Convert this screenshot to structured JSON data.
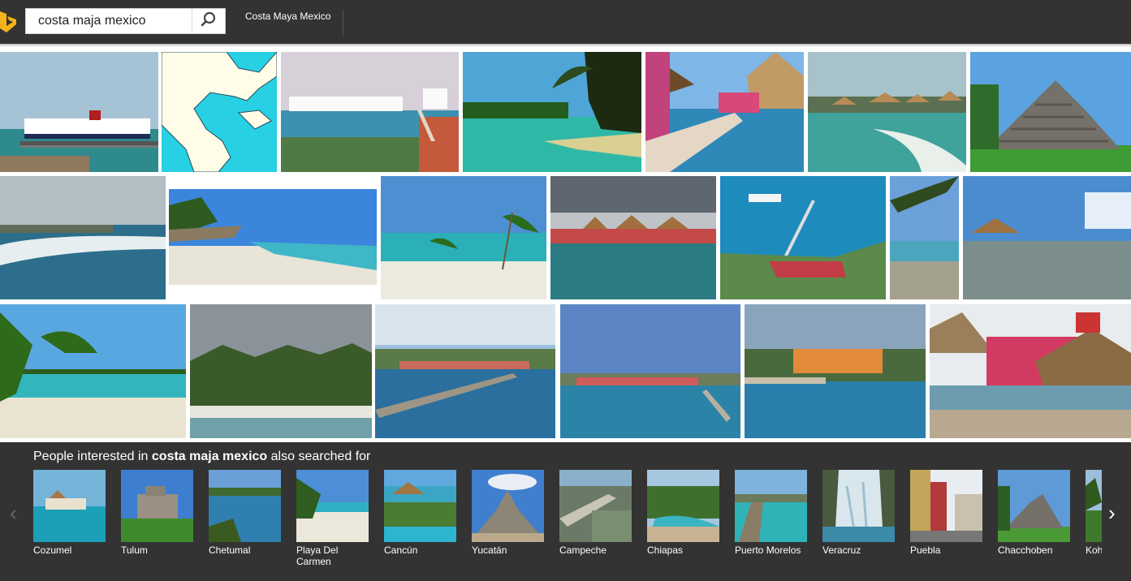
{
  "search": {
    "query": "costa maja mexico"
  },
  "header": {
    "tab_label": "Costa Maya Mexico"
  },
  "icons": {
    "logo": "bing-logo-icon",
    "search": "search-icon",
    "prev": "chevron-left-icon",
    "next": "chevron-right-icon"
  },
  "colors": {
    "header_bg": "#333333",
    "logo": "#f5b21b",
    "section_bg": "#333333"
  },
  "images": [
    "cruise ship at pier",
    "map of gulf of mexico",
    "cruise ships in port",
    "palm tree lagoon",
    "pink resort pool",
    "coastal huts",
    "mayan pyramid",
    "shoreline waves",
    "beach umbrellas",
    "palms on beach",
    "red roof resort",
    "aerial pier view",
    "palm tree rocks",
    "rocky coast palapa",
    "tropical beach palms",
    "palm grove beach",
    "long pier",
    "harbor with pier",
    "orange building coast",
    "colorful market"
  ],
  "related": {
    "title_prefix": "People interested in",
    "title_query": "costa maja mexico",
    "title_suffix": "also searched for",
    "items": [
      {
        "label": "Cozumel"
      },
      {
        "label": "Tulum"
      },
      {
        "label": "Chetumal"
      },
      {
        "label": "Playa Del Carmen"
      },
      {
        "label": "Cancún"
      },
      {
        "label": "Yucatán"
      },
      {
        "label": "Campeche"
      },
      {
        "label": "Chiapas"
      },
      {
        "label": "Puerto Morelos"
      },
      {
        "label": "Veracruz"
      },
      {
        "label": "Puebla"
      },
      {
        "label": "Chacchoben"
      },
      {
        "label": "Koh"
      }
    ],
    "prev_glyph": "‹",
    "next_glyph": "›"
  }
}
